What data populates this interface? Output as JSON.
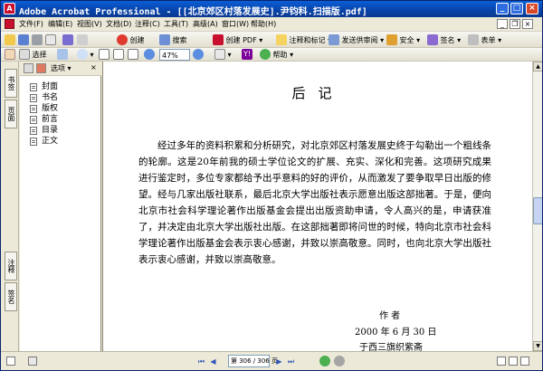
{
  "window": {
    "title": "Adobe Acrobat Professional - [[北京郊区村落发展史].尹钧科.扫描版.pdf]"
  },
  "menu": {
    "items": [
      "文件(F)",
      "编辑(E)",
      "视图(V)",
      "文档(D)",
      "注释(C)",
      "工具(T)",
      "高级(A)",
      "窗口(W)",
      "帮助(H)"
    ]
  },
  "toolbar1": {
    "items": [
      "创建",
      "搜索",
      "创建 PDF",
      "注释和标记",
      "发送供审阅",
      "安全",
      "签名",
      "表单"
    ]
  },
  "toolbar2": {
    "select_label": "选择",
    "zoom_value": "47%",
    "help_label": "帮助"
  },
  "nav_tabs": {
    "tab_top_1": "书签",
    "tab_top_2": "页面",
    "tab_bottom_1": "注释",
    "tab_bottom_2": "签名"
  },
  "bookmarks": {
    "options_label": "选项",
    "items": [
      {
        "label": "封面"
      },
      {
        "label": "书名"
      },
      {
        "label": "版权"
      },
      {
        "label": "前言"
      },
      {
        "label": "目录"
      },
      {
        "label": "正文"
      }
    ]
  },
  "document": {
    "heading": "后记",
    "paragraph": "经过多年的资料积累和分析研究，对北京郊区村落发展史终于勾勒出一个粗线条的轮廓。这是20年前我的硕士学位论文的扩展、充实、深化和完善。这项研究成果进行鉴定时，多位专家都给予出乎意料的好的评价，从而激发了要争取早日出版的修望。经与几家出版社联系，最后北京大学出版社表示愿意出版这部拙著。于是，便向北京市社会科学理论著作出版基金会提出出版资助申请，令人高兴的是，申请获准了，并决定由北京大学出版社出版。在这部拙著即将问世的时候，特向北京市社会科学理论著作出版基金会表示衷心感谢，并致以崇高敬意。同时，也向北京大学出版社表示衷心感谢，并致以崇高敬意。",
    "author_label": "作    者",
    "date": "2000 年 6 月 30 日",
    "place": "于西三旗织紫斋"
  },
  "statusbar": {
    "page_display": "第 306 / 306 页"
  },
  "colors": {
    "titlebar": "#0842a8",
    "accent_red": "#c8102e"
  }
}
